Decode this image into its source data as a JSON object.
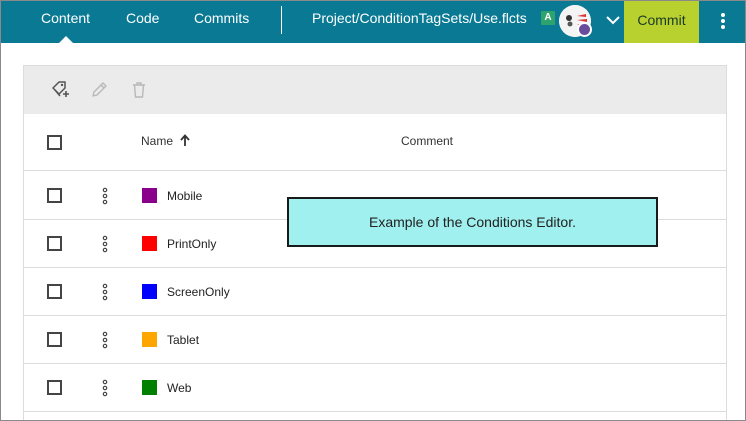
{
  "nav": {
    "tabs": [
      {
        "label": "Content"
      },
      {
        "label": "Code"
      },
      {
        "label": "Commits"
      }
    ],
    "file_path": "Project/ConditionTagSets/Use.flcts",
    "badge": "A",
    "commit_label": "Commit"
  },
  "table": {
    "columns": {
      "name": "Name",
      "comment": "Comment"
    },
    "sort": "ascending",
    "rows": [
      {
        "name": "Mobile",
        "color": "#8b008b"
      },
      {
        "name": "PrintOnly",
        "color": "#ff0000"
      },
      {
        "name": "ScreenOnly",
        "color": "#0000ff"
      },
      {
        "name": "Tablet",
        "color": "#ffa500"
      },
      {
        "name": "Web",
        "color": "#008000"
      }
    ]
  },
  "callout": {
    "text": "Example of the Conditions Editor."
  },
  "colors": {
    "topbar": "#0a7a94",
    "commit_button": "#b9d12f",
    "callout_bg": "#9ff0ee"
  },
  "icons": [
    "add-tag-icon",
    "edit-pencil-icon",
    "delete-trash-icon",
    "sort-arrow-up-icon",
    "chevron-down-icon",
    "kebab-menu-icon"
  ]
}
